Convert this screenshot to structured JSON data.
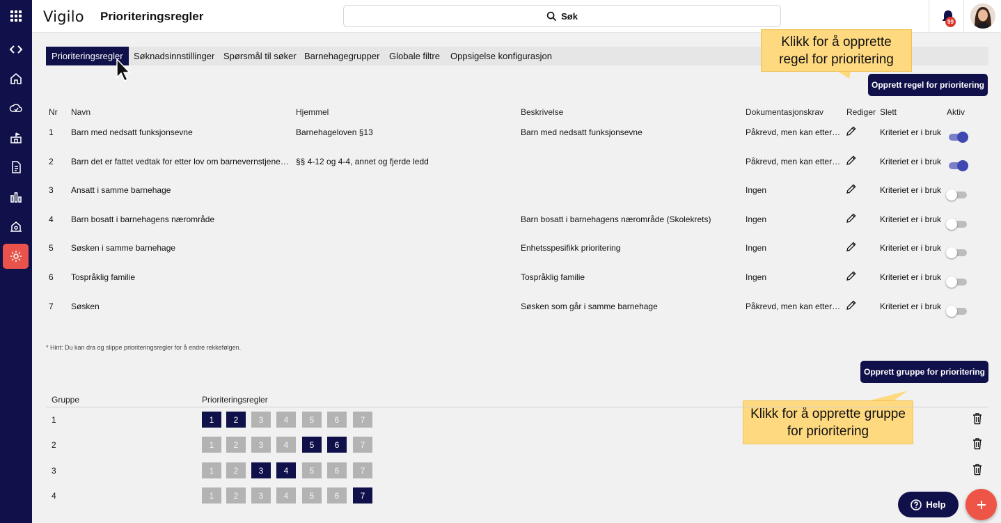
{
  "app": {
    "brand": "Vigilo",
    "page_title": "Prioriteringsregler"
  },
  "search": {
    "label": "Søk"
  },
  "notifications": {
    "badge": "99"
  },
  "rail": [
    {
      "icon": "apps-grid-icon"
    },
    {
      "icon": "expand-code-icon"
    },
    {
      "icon": "home-icon"
    },
    {
      "icon": "cloud-sync-icon"
    },
    {
      "icon": "kindergarten-icon"
    },
    {
      "icon": "document-icon"
    },
    {
      "icon": "bar-chart-icon"
    },
    {
      "icon": "building-admin-icon"
    },
    {
      "icon": "settings-gear-icon",
      "active": true
    }
  ],
  "tabs": [
    {
      "label": "Prioriteringsregler",
      "active": true
    },
    {
      "label": "Søknadsinnstillinger"
    },
    {
      "label": "Spørsmål til søker"
    },
    {
      "label": "Barnehagegrupper"
    },
    {
      "label": "Globale filtre"
    },
    {
      "label": "Oppsigelse konfigurasjon"
    }
  ],
  "callouts": {
    "rule": "Klikk for å opprette regel for prioritering",
    "group": "Klikk for å opprette gruppe for prioritering"
  },
  "actions": {
    "create_rule": "Opprett regel for prioritering",
    "create_group": "Opprett gruppe for prioritering"
  },
  "rules_table": {
    "headers": {
      "nr": "Nr",
      "navn": "Navn",
      "hjemmel": "Hjemmel",
      "beskrivelse": "Beskrivelse",
      "dok": "Dokumentasjonskrav",
      "rediger": "Rediger",
      "slett": "Slett",
      "aktiv": "Aktiv"
    },
    "rows": [
      {
        "nr": "1",
        "navn": "Barn med nedsatt funksjonsevne",
        "hjemmel": "Barnehageloven §13",
        "beskrivelse": "Barn med nedsatt funksjonsevne",
        "dok": "Påkrevd, men kan etterse...",
        "slett": "Kriteriet er i bruk",
        "aktiv": true
      },
      {
        "nr": "2",
        "navn": "Barn det er fattet vedtak for etter lov om barnevernstjenester",
        "hjemmel": "§§ 4-12 og 4-4, annet og fjerde ledd",
        "beskrivelse": "",
        "dok": "Påkrevd, men kan etterse...",
        "slett": "Kriteriet er i bruk",
        "aktiv": true
      },
      {
        "nr": "3",
        "navn": "Ansatt i samme barnehage",
        "hjemmel": "",
        "beskrivelse": "",
        "dok": "Ingen",
        "slett": "Kriteriet er i bruk",
        "aktiv": false
      },
      {
        "nr": "4",
        "navn": "Barn bosatt i barnehagens nærområde",
        "hjemmel": "",
        "beskrivelse": "Barn bosatt i barnehagens nærområde (Skolekrets)",
        "dok": "Ingen",
        "slett": "Kriteriet er i bruk",
        "aktiv": false
      },
      {
        "nr": "5",
        "navn": "Søsken i samme barnehage",
        "hjemmel": "",
        "beskrivelse": "Enhetsspesifikk prioritering",
        "dok": "Ingen",
        "slett": "Kriteriet er i bruk",
        "aktiv": false
      },
      {
        "nr": "6",
        "navn": "Tospråklig familie",
        "hjemmel": "",
        "beskrivelse": "Tospråklig familie",
        "dok": "Ingen",
        "slett": "Kriteriet er i bruk",
        "aktiv": false
      },
      {
        "nr": "7",
        "navn": "Søsken",
        "hjemmel": "",
        "beskrivelse": "Søsken som går i samme barnehage",
        "dok": "Påkrevd, men kan etterse...",
        "slett": "Kriteriet er i bruk",
        "aktiv": false
      }
    ]
  },
  "hint": "* Hint: Du kan dra og slippe prioriteringsregler for å endre rekkefølgen.",
  "groups_table": {
    "headers": {
      "gruppe": "Gruppe",
      "regler": "Prioriteringsregler"
    },
    "chips": [
      "1",
      "2",
      "3",
      "4",
      "5",
      "6",
      "7"
    ],
    "rows": [
      {
        "gruppe": "1",
        "selected": [
          "1",
          "2"
        ]
      },
      {
        "gruppe": "2",
        "selected": [
          "5",
          "6"
        ]
      },
      {
        "gruppe": "3",
        "selected": [
          "3",
          "4"
        ]
      },
      {
        "gruppe": "4",
        "selected": [
          "7"
        ]
      }
    ]
  },
  "help": {
    "label": "Help"
  },
  "colors": {
    "navy": "#10104a",
    "accent_red": "#ee5547",
    "callout": "#ffd980",
    "toggle_on": "#3f48b0"
  }
}
